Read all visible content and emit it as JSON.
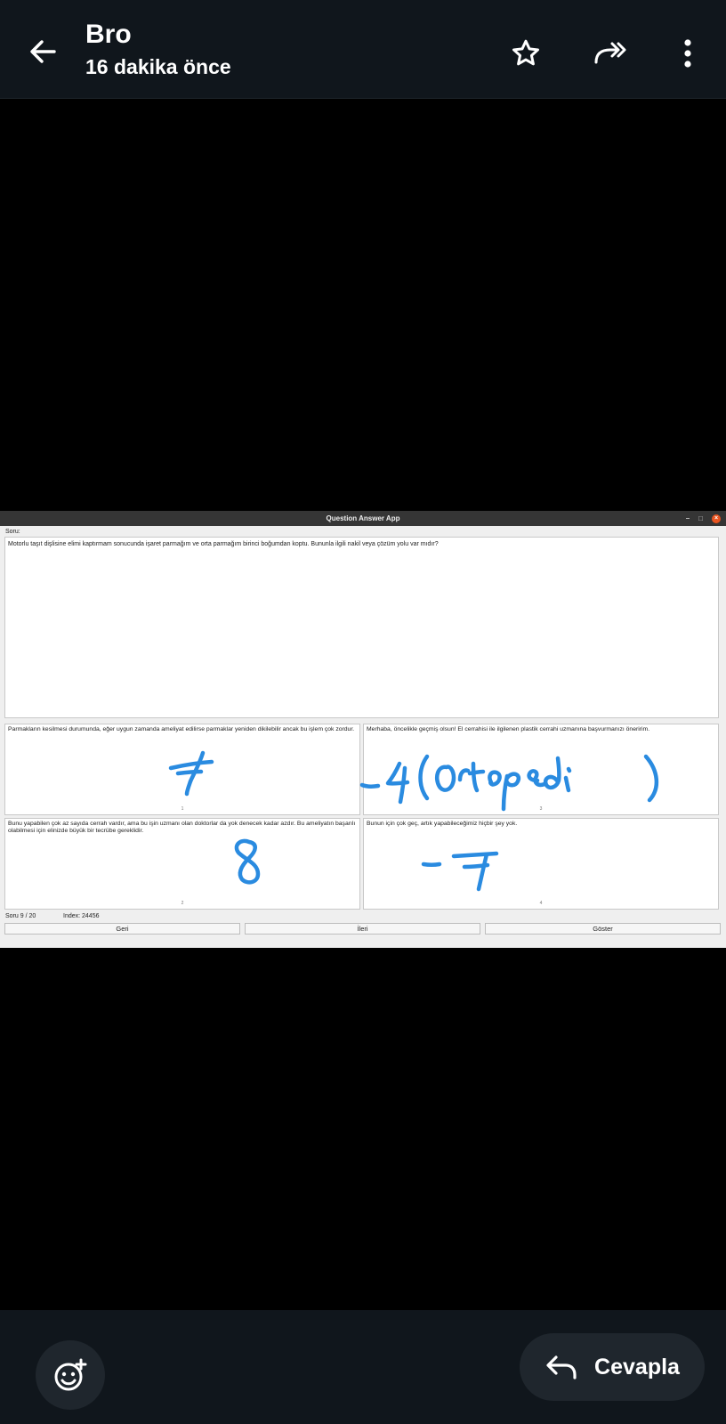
{
  "header": {
    "title": "Bro",
    "subtitle": "16 dakika önce",
    "icons": [
      "back-arrow-icon",
      "star-icon",
      "forward-all-icon",
      "more-vert-icon"
    ]
  },
  "app": {
    "window_title": "Question Answer App",
    "question_label": "Soru:",
    "question_text": "Motorlu taşıt dişlisine elimi kaptırmam sonucunda işaret parmağım ve orta parmağım birinci boğumdan koptu. Bununla ilgili nakil veya çözüm yolu var mıdır?",
    "answers": [
      {
        "text": "Parmakların kesilmesi durumunda, eğer uygun zamanda ameliyat edilirse parmaklar yeniden dikilebilir ancak bu işlem çok zordur.",
        "number": "1"
      },
      {
        "text": "Merhaba, öncelikle geçmiş olsun! El cerrahisi ile ilgilenen plastik cerrahi uzmanına başvurmanızı öneririm.",
        "number": "3"
      },
      {
        "text": "Bunu yapabilen çok az sayıda cerrah vardır, ama bu işin uzmanı olan doktorlar da yok denecek kadar azdır. Bu ameliyatın başarılı olabilmesi için elinizde büyük bir tecrübe gereklidir.",
        "number": "2"
      },
      {
        "text": "Bunun için çok geç, artık yapabileceğimiz hiçbir şey yok.",
        "number": "4"
      }
    ],
    "counter": "Soru 9 / 20",
    "index": "Index: 24456",
    "buttons": {
      "back": "Geri",
      "next": "İleri",
      "show": "Göster"
    }
  },
  "annotations": {
    "a1": "7",
    "a3": "-4 (Ortopedi)",
    "a2": "8",
    "a4": "-7",
    "color": "#2a8be0"
  },
  "footer": {
    "reply_label": "Cevapla",
    "icons": [
      "emoji-add-icon",
      "reply-icon"
    ]
  }
}
